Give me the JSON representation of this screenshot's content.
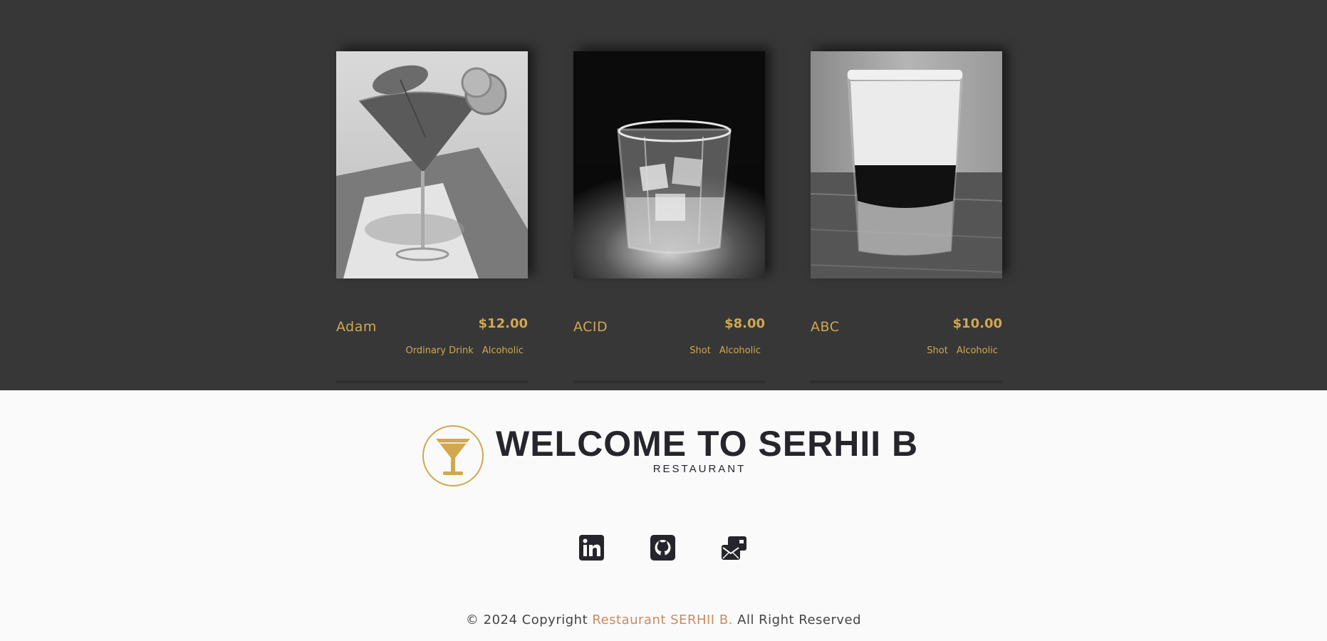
{
  "menu": {
    "items": [
      {
        "name": "Adam",
        "price": "$12.00",
        "tags": [
          "Ordinary Drink",
          "Alcoholic"
        ],
        "image": "martini-glass-photo"
      },
      {
        "name": "ACID",
        "price": "$8.00",
        "tags": [
          "Shot",
          "Alcoholic"
        ],
        "image": "rocks-glass-photo"
      },
      {
        "name": "ABC",
        "price": "$10.00",
        "tags": [
          "Shot",
          "Alcoholic"
        ],
        "image": "layered-shot-photo"
      }
    ]
  },
  "brand": {
    "title": "WELCOME TO SERHII B",
    "subtitle": "RESTAURANT",
    "logo_icon": "cocktail-icon",
    "accent_color": "#d2a74f"
  },
  "social": [
    {
      "icon": "linkedin-icon"
    },
    {
      "icon": "github-icon"
    },
    {
      "icon": "email-icon"
    }
  ],
  "footer": {
    "prefix": "© 2024 Copyright",
    "brand": "Restaurant SERHII B.",
    "suffix": "All Right Reserved",
    "accent_color": "#c98a62"
  },
  "colors": {
    "dark_bg": "#373737",
    "light_bg": "#fafafa",
    "gold": "#d2a74f",
    "text_dark": "#25252b"
  }
}
